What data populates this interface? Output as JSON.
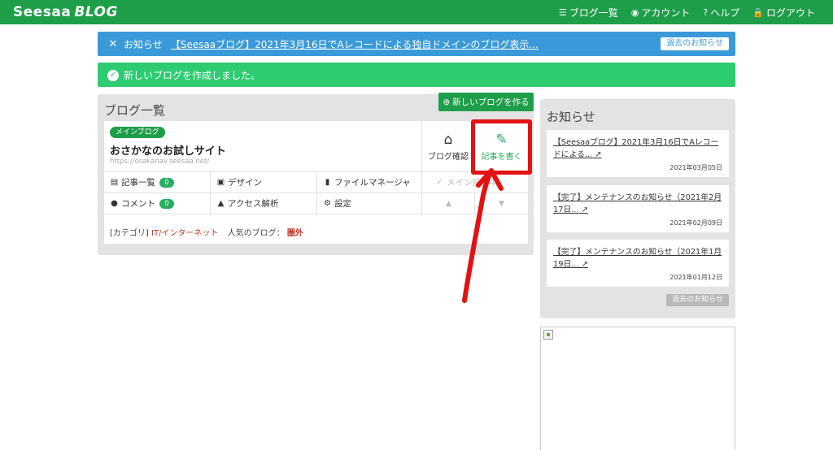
{
  "app": {
    "logo_main": "Seesaa",
    "logo_sub": "BLOG"
  },
  "nav": [
    {
      "icon": "list-icon",
      "label": "ブログ一覧"
    },
    {
      "icon": "account-icon",
      "label": "アカウント"
    },
    {
      "icon": "help-icon",
      "label": "ヘルプ"
    },
    {
      "icon": "lock-icon",
      "label": "ログアウト"
    }
  ],
  "info_alert": {
    "label": "お知らせ",
    "link": "【Seesaaブログ】2021年3月16日でAレコードによる独自ドメインのブログ表示...",
    "button": "過去のお知らせ"
  },
  "success_alert": {
    "message": "新しいブログを作成しました。"
  },
  "blog_list": {
    "title": "ブログ一覧",
    "new_button": "新しいブログを作る",
    "blog": {
      "badge": "メインブログ",
      "name": "おさかなのお試しサイト",
      "url": "https://osakanav.seesaa.net/",
      "view_label": "ブログ確認",
      "write_label": "記事を書く"
    },
    "row1": {
      "articles": "記事一覧",
      "articles_count": "0",
      "design": "デザイン",
      "file_manager": "ファイルマネージャ",
      "main_setting": "メイン設定中"
    },
    "row2": {
      "comments": "コメント",
      "comments_count": "0",
      "analytics": "アクセス解析",
      "settings": "設定",
      "up": "▲",
      "down": "▼"
    },
    "category_label": "[カテゴリ]",
    "category_value": "IT/インターネット",
    "popular_label": "人気のブログ：",
    "popular_value": "圏外"
  },
  "sidebar": {
    "title": "お知らせ",
    "news": [
      {
        "title": "【Seesaaブログ】2021年3月16日でAレコードによる...",
        "date": "2021年03月05日"
      },
      {
        "title": "【完了】メンテナンスのお知らせ（2021年2月17日...",
        "date": "2021年02月09日"
      },
      {
        "title": "【完了】メンテナンスのお知らせ（2021年1月19日...",
        "date": "2021年01月12日"
      }
    ],
    "past_button": "過去のお知らせ"
  },
  "colors": {
    "brand_green": "#1e9e49",
    "info_blue": "#3a9ad9",
    "success_green": "#2ecc71",
    "annotation_red": "#e31212"
  }
}
